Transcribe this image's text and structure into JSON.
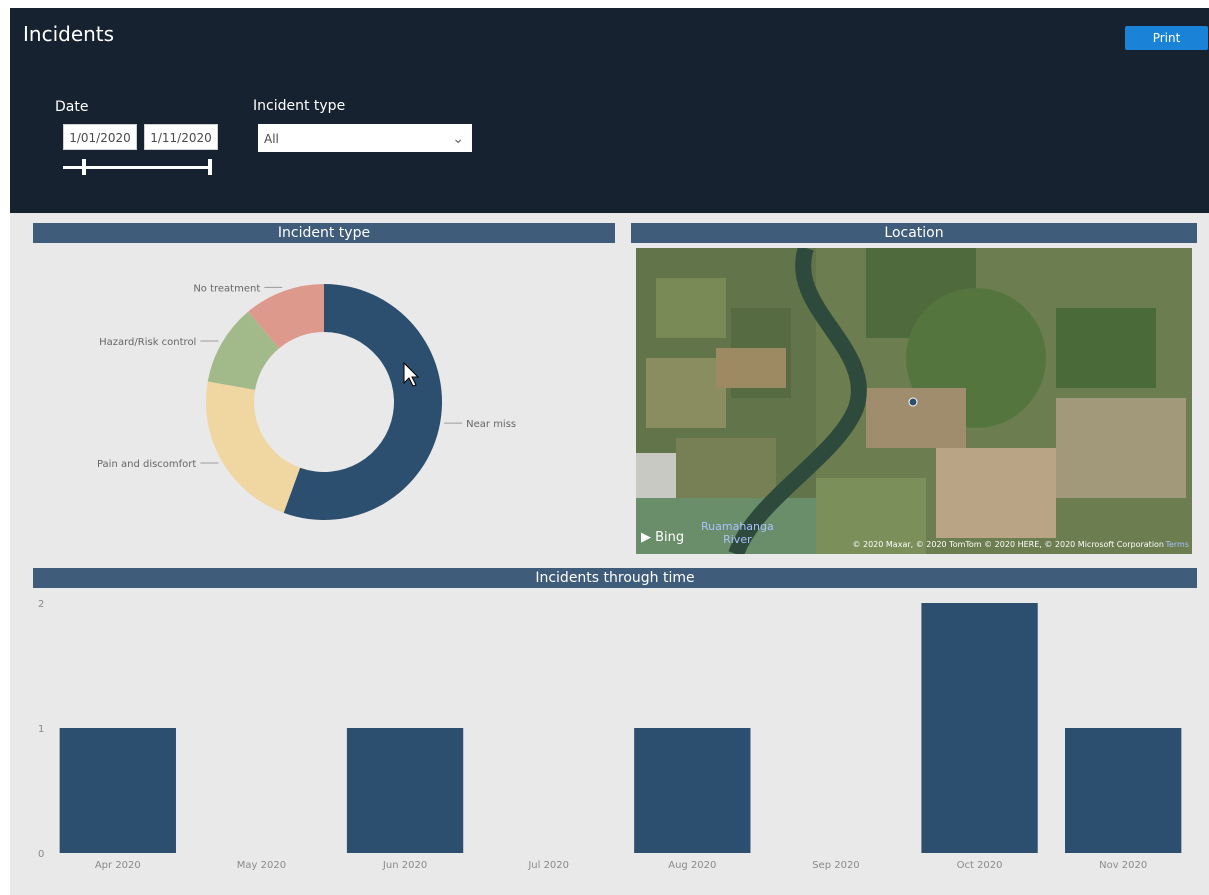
{
  "header": {
    "title": "Incidents",
    "print_label": "Print",
    "date_label": "Date",
    "date_start": "1/01/2020",
    "date_end": "1/11/2020",
    "incident_type_label": "Incident type",
    "incident_type_value": "All",
    "date_slider_start": 0.13
  },
  "donut": {
    "title": "Incident type",
    "slices": [
      {
        "name": "Near miss",
        "value": 5,
        "color": "#2c4f6f"
      },
      {
        "name": "Pain and discomfort",
        "value": 2,
        "color": "#f0d6a1"
      },
      {
        "name": "Hazard/Risk control",
        "value": 1,
        "color": "#a2ba8a"
      },
      {
        "name": "No treatment",
        "value": 1,
        "color": "#dd9a8c"
      }
    ]
  },
  "map": {
    "title": "Location",
    "bing_label": "Bing",
    "river_label_line1": "Ruamahanga",
    "river_label_line2": "River",
    "credit": "© 2020 Maxar, © 2020 TomTom © 2020 HERE, © 2020 Microsoft Corporation",
    "terms": "Terms"
  },
  "timeline": {
    "title": "Incidents through time"
  },
  "chart_data": {
    "type": "bar",
    "title": "Incidents through time",
    "categories": [
      "Apr 2020",
      "May 2020",
      "Jun 2020",
      "Jul 2020",
      "Aug 2020",
      "Sep 2020",
      "Oct 2020",
      "Nov 2020"
    ],
    "values": [
      1,
      0,
      1,
      0,
      1,
      0,
      2,
      1
    ],
    "yticks": [
      "0",
      "1",
      "2"
    ],
    "ylim": [
      0,
      2
    ],
    "color": "#2c4f6f",
    "grid": false
  }
}
